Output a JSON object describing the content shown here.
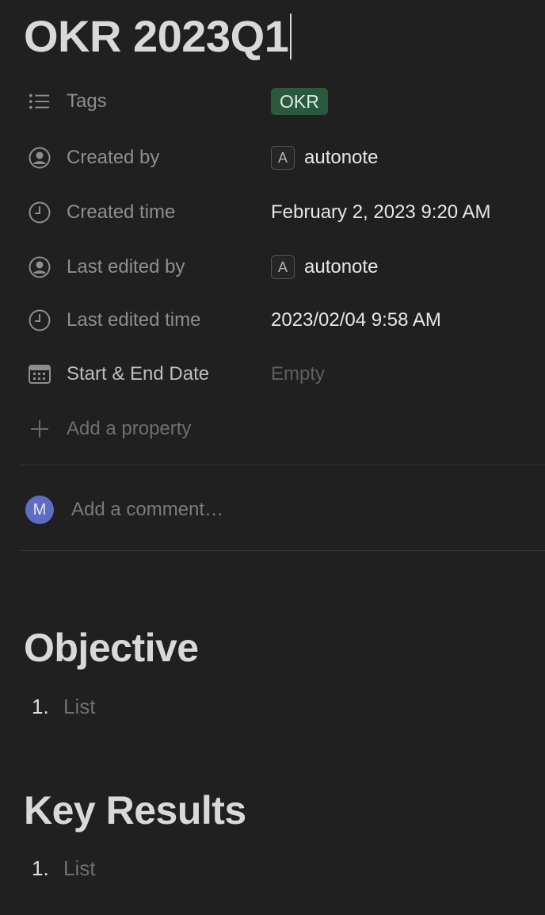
{
  "page": {
    "title": "OKR 2023Q1"
  },
  "properties": {
    "tags": {
      "label": "Tags",
      "icon": "list-icon",
      "value": "OKR",
      "tag_color": "#2b593f"
    },
    "created_by": {
      "label": "Created by",
      "icon": "person-icon",
      "avatar_letter": "A",
      "value": "autonote"
    },
    "created_time": {
      "label": "Created time",
      "icon": "clock-icon",
      "value": "February 2, 2023 9:20 AM"
    },
    "last_edited_by": {
      "label": "Last edited by",
      "icon": "person-icon",
      "avatar_letter": "A",
      "value": "autonote"
    },
    "last_edited_time": {
      "label": "Last edited time",
      "icon": "clock-icon",
      "value": "2023/02/04 9:58 AM"
    },
    "start_end_date": {
      "label": "Start & End Date",
      "icon": "calendar-icon",
      "value": "Empty"
    },
    "add_property": {
      "label": "Add a property",
      "icon": "plus-icon"
    }
  },
  "comment": {
    "avatar_letter": "M",
    "avatar_color": "#5f6cc4",
    "placeholder": "Add a comment…"
  },
  "sections": [
    {
      "heading": "Objective",
      "list_number": "1.",
      "list_placeholder": "List"
    },
    {
      "heading": "Key Results",
      "list_number": "1.",
      "list_placeholder": "List"
    }
  ]
}
